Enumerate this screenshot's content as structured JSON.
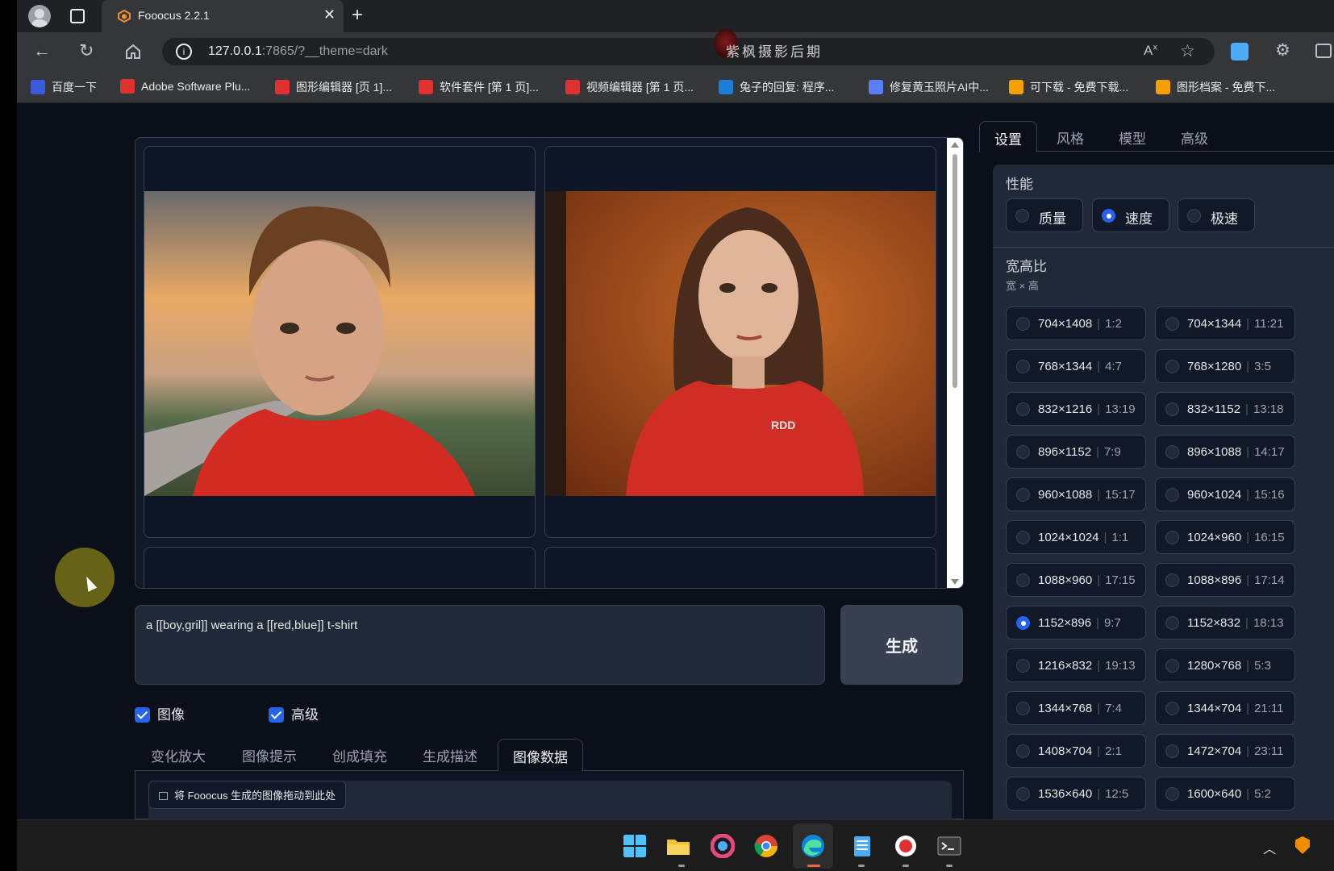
{
  "browser": {
    "tab_title": "Fooocus 2.2.1",
    "url_host": "127.0.0.1",
    "url_rest": ":7865/?__theme=dark",
    "watermark": "紫枫摄影后期",
    "bookmarks": [
      {
        "label": "百度一下",
        "color": "#3b5bdb"
      },
      {
        "label": "Adobe Software Plu...",
        "color": "#e03131"
      },
      {
        "label": "图形编辑器 [页 1]...",
        "color": "#e03131"
      },
      {
        "label": "软件套件 [第 1 页]...",
        "color": "#e03131"
      },
      {
        "label": "视频编辑器 [第 1 页...",
        "color": "#e03131"
      },
      {
        "label": "兔子的回复: 程序...",
        "color": "#1c7ed6"
      },
      {
        "label": "修复黄玉照片AI中...",
        "color": "#5c7cfa"
      },
      {
        "label": "可下载 - 免费下载...",
        "color": "#f59f00"
      },
      {
        "label": "图形档案 - 免费下...",
        "color": "#f59f00"
      }
    ]
  },
  "prompt": {
    "text": "a [[boy,gril]] wearing a [[red,blue]] t-shirt",
    "generate_label": "生成"
  },
  "checkboxes": {
    "image": "图像",
    "advanced": "高级"
  },
  "bottom_tabs": [
    "变化放大",
    "图像提示",
    "创成填充",
    "生成描述",
    "图像数据"
  ],
  "drop_label": "将 Fooocus 生成的图像拖动到此处",
  "right_tabs": [
    "设置",
    "风格",
    "模型",
    "高级"
  ],
  "performance": {
    "title": "性能",
    "options": [
      "质量",
      "速度",
      "极速"
    ],
    "selected": "速度"
  },
  "aspect": {
    "title": "宽高比",
    "subtitle": "宽 × 高",
    "selected": "1152×896",
    "options": [
      {
        "dim": "704×1408",
        "ratio": "1:2"
      },
      {
        "dim": "704×1344",
        "ratio": "11:21"
      },
      {
        "dim": "768×1344",
        "ratio": "4:7"
      },
      {
        "dim": "768×1280",
        "ratio": "3:5"
      },
      {
        "dim": "832×1216",
        "ratio": "13:19"
      },
      {
        "dim": "832×1152",
        "ratio": "13:18"
      },
      {
        "dim": "896×1152",
        "ratio": "7:9"
      },
      {
        "dim": "896×1088",
        "ratio": "14:17"
      },
      {
        "dim": "960×1088",
        "ratio": "15:17"
      },
      {
        "dim": "960×1024",
        "ratio": "15:16"
      },
      {
        "dim": "1024×1024",
        "ratio": "1:1"
      },
      {
        "dim": "1024×960",
        "ratio": "16:15"
      },
      {
        "dim": "1088×960",
        "ratio": "17:15"
      },
      {
        "dim": "1088×896",
        "ratio": "17:14"
      },
      {
        "dim": "1152×896",
        "ratio": "9:7"
      },
      {
        "dim": "1152×832",
        "ratio": "18:13"
      },
      {
        "dim": "1216×832",
        "ratio": "19:13"
      },
      {
        "dim": "1280×768",
        "ratio": "5:3"
      },
      {
        "dim": "1344×768",
        "ratio": "7:4"
      },
      {
        "dim": "1344×704",
        "ratio": "21:11"
      },
      {
        "dim": "1408×704",
        "ratio": "2:1"
      },
      {
        "dim": "1472×704",
        "ratio": "23:11"
      },
      {
        "dim": "1536×640",
        "ratio": "12:5"
      },
      {
        "dim": "1600×640",
        "ratio": "5:2"
      }
    ]
  },
  "accent_color": "#2563eb"
}
